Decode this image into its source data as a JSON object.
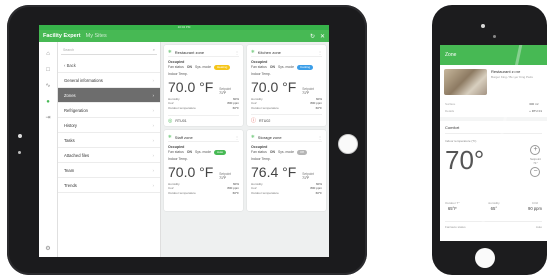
{
  "colors": {
    "accent": "#47b954",
    "heating": "#f5c518",
    "cooling": "#3b9ee8",
    "auto": "#47b954",
    "off": "#b5b5b5",
    "alarm": "#e0473f"
  },
  "tablet": {
    "status_time": "10:04 PM",
    "app_title": "Facility Expert",
    "site_name": "My Sites",
    "rail_icons": [
      "home-icon",
      "calendar-icon",
      "chart-icon",
      "location-pin-icon",
      "logout-icon",
      "settings-icon"
    ],
    "search_placeholder": "Search",
    "back_label": "Back",
    "menu_items": [
      "General informations",
      "Zones",
      "Refrigeration",
      "History",
      "Tasks",
      "Attached files",
      "Team",
      "Trends"
    ],
    "cards": [
      {
        "title": "Restaurant zone",
        "occupancy": "Occupied",
        "fan_label": "Fan status",
        "fan_value": "ON",
        "sys_label": "Sys. mode",
        "mode": "Heating",
        "mode_color": "#f5c518",
        "temp_label": "Indoor Temp.",
        "temp": "70.0 °F",
        "setpoint_label": "Setpoint",
        "setpoint": "71°F",
        "stats": [
          [
            "Humidity",
            "60%"
          ],
          [
            "Co2",
            "800 ppm"
          ],
          [
            "Outdoor temperature",
            "60°F"
          ]
        ],
        "device": "RTU01",
        "device_status": "ok"
      },
      {
        "title": "Kitchen zone",
        "occupancy": "Occupied",
        "fan_label": "Fan status",
        "fan_value": "ON",
        "sys_label": "Sys. mode",
        "mode": "Cooling",
        "mode_color": "#3b9ee8",
        "temp_label": "Indoor Temp.",
        "temp": "70.0 °F",
        "setpoint_label": "Setpoint",
        "setpoint": "71°F",
        "stats": [
          [
            "Humidity",
            "60%"
          ],
          [
            "Co2",
            "800 ppm"
          ],
          [
            "Outdoor temperature",
            "60°F"
          ]
        ],
        "device": "RTU02",
        "device_status": "alarm"
      },
      {
        "title": "Staff zone",
        "occupancy": "Occupied",
        "fan_label": "Fan status",
        "fan_value": "ON",
        "sys_label": "Sys. mode",
        "mode": "Auto",
        "mode_color": "#47b954",
        "temp_label": "Indoor Temp.",
        "temp": "70.0 °F",
        "setpoint_label": "Setpoint",
        "setpoint": "71°F",
        "stats": [
          [
            "Humidity",
            "60%"
          ],
          [
            "Co2",
            "800 ppm"
          ],
          [
            "Outdoor temperature",
            "60°F"
          ]
        ]
      },
      {
        "title": "Storage zone",
        "occupancy": "Occupied",
        "fan_label": "Fan status",
        "fan_value": "ON",
        "sys_label": "Sys. mode",
        "mode": "Off",
        "mode_color": "#b5b5b5",
        "temp_label": "Indoor Temp.",
        "temp": "76.4 °F",
        "setpoint_label": "Setpoint",
        "setpoint": "71°F",
        "stats": [
          [
            "Humidity",
            "60%"
          ],
          [
            "Co2",
            "800 ppm"
          ],
          [
            "Outdoor temperature",
            "60°F"
          ]
        ]
      }
    ]
  },
  "phone": {
    "header": "Zone",
    "site_title": "Restaurant zone",
    "site_sub": "Burger King / Burger King Paris",
    "meta": [
      [
        "Surface",
        "300 m²"
      ],
      [
        "Details",
        "+ RTU 01"
      ]
    ],
    "zone_title": "Comfort",
    "temp_label": "Indoor temperature (°F)",
    "temp": "70°",
    "setpoint_label": "Setpoint",
    "setpoint": "71°",
    "readings": [
      [
        "Outdoor T°",
        "65°F"
      ],
      [
        "Humidity",
        "65°"
      ],
      [
        "CO2",
        "90 ppm"
      ]
    ],
    "bottom": [
      [
        "Fan/auto status",
        "Auto"
      ]
    ]
  }
}
